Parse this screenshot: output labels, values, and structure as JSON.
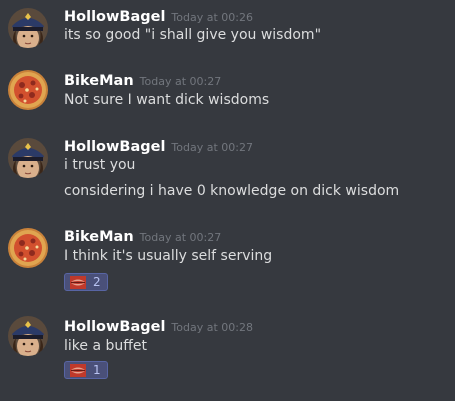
{
  "messages": [
    {
      "author": "HollowBagel",
      "timestamp": "Today at 00:26",
      "avatar_icon": "captain-avatar",
      "lines": [
        "its so good \"i shall give you wisdom\""
      ]
    },
    {
      "author": "BikeMan",
      "timestamp": "Today at 00:27",
      "avatar_icon": "pizza-avatar",
      "lines": [
        "Not sure I want dick wisdoms"
      ]
    },
    {
      "author": "HollowBagel",
      "timestamp": "Today at 00:27",
      "avatar_icon": "captain-avatar",
      "lines": [
        "i trust you",
        "considering i have 0 knowledge on dick wisdom"
      ]
    },
    {
      "author": "BikeMan",
      "timestamp": "Today at 00:27",
      "avatar_icon": "pizza-avatar",
      "lines": [
        "I think it's usually self serving"
      ],
      "reaction": {
        "emoji_icon": "lips-emoji-icon",
        "count": "2"
      }
    },
    {
      "author": "HollowBagel",
      "timestamp": "Today at 00:28",
      "avatar_icon": "captain-avatar",
      "lines": [
        "like a buffet"
      ],
      "reaction": {
        "emoji_icon": "lips-emoji-icon",
        "count": "1"
      }
    }
  ],
  "colors": {
    "background": "#36393f",
    "username": "#ffffff",
    "timestamp": "#72767d",
    "text": "#dcddde",
    "reaction_bg": "#4a5079",
    "reaction_count": "#b9c3f2"
  }
}
